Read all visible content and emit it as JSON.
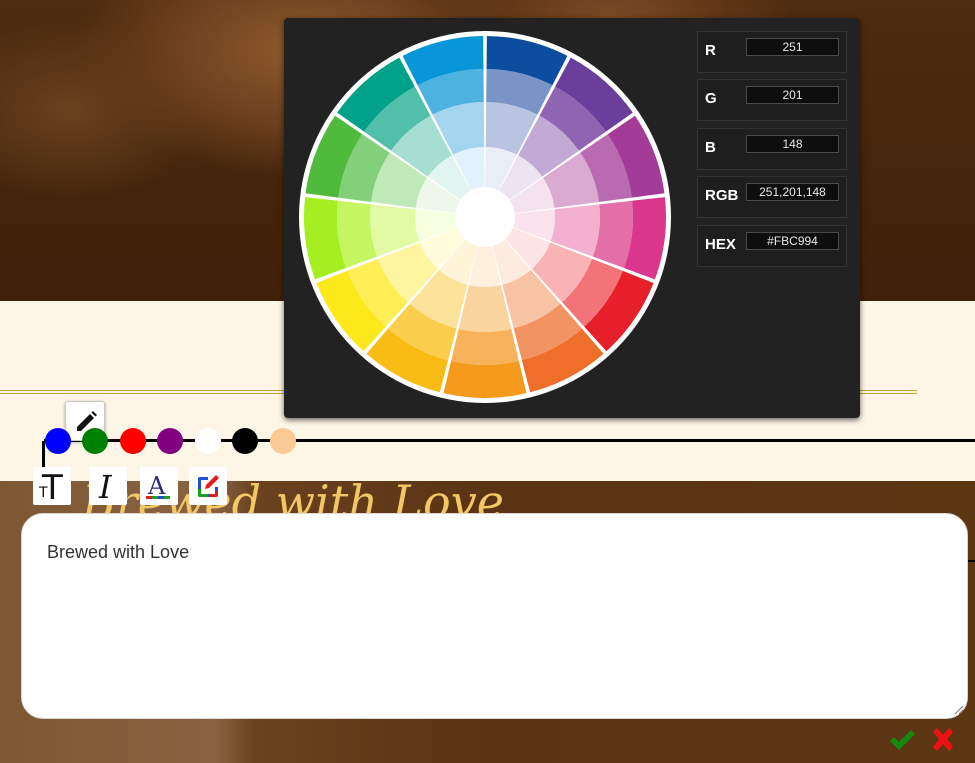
{
  "page": {
    "hero_heading": "Brewed with Love"
  },
  "color_picker": {
    "channels": [
      {
        "label": "R",
        "value": "251"
      },
      {
        "label": "G",
        "value": "201"
      },
      {
        "label": "B",
        "value": "148"
      },
      {
        "label": "RGB",
        "value": "251,201,148"
      },
      {
        "label": "HEX",
        "value": "#FBC994"
      }
    ],
    "wheel_colors": [
      [
        "#e8edf7",
        "#b9c4e0",
        "#7a94c8",
        "#0d4da0"
      ],
      [
        "#ece4f2",
        "#c2aad4",
        "#8e64b3",
        "#6a3e9b"
      ],
      [
        "#f4e2ef",
        "#dbaad2",
        "#b96ab0",
        "#a23c96"
      ],
      [
        "#fbe3ee",
        "#f3b1cf",
        "#e36ea8",
        "#d9368c"
      ],
      [
        "#fde5e5",
        "#f9b3b5",
        "#f27479",
        "#e61f2a"
      ],
      [
        "#fdebe0",
        "#f8c2a4",
        "#f29362",
        "#ef6f2a"
      ],
      [
        "#fef0dc",
        "#fbd5a0",
        "#f8b25a",
        "#f59a1c"
      ],
      [
        "#fff3d8",
        "#fde39a",
        "#fbce4d",
        "#f9bc14"
      ],
      [
        "#fffbdb",
        "#fff49f",
        "#ffee56",
        "#fde81c"
      ],
      [
        "#f6ffe0",
        "#e0fba4",
        "#c5f560",
        "#a4ee22"
      ],
      [
        "#eef8ea",
        "#bfe9b6",
        "#83d07a",
        "#4fba3c"
      ],
      [
        "#e3f5f1",
        "#a6ded2",
        "#52bfaa",
        "#02a18a"
      ],
      [
        "#e2f2fa",
        "#a3d5ef",
        "#4db2e0",
        "#0896d8"
      ]
    ]
  },
  "toolbar": {
    "pen_icon": "pencil-icon",
    "swatches": [
      {
        "name": "blue",
        "color": "#0000ff"
      },
      {
        "name": "green",
        "color": "#008000"
      },
      {
        "name": "red",
        "color": "#ff0000"
      },
      {
        "name": "purple",
        "color": "#800080"
      },
      {
        "name": "white",
        "color": "#ffffff"
      },
      {
        "name": "black",
        "color": "#000000"
      },
      {
        "name": "peach",
        "color": "#fbc994"
      }
    ],
    "tools": [
      {
        "name": "font-size-icon"
      },
      {
        "name": "italic-icon"
      },
      {
        "name": "text-color-icon"
      },
      {
        "name": "edit-icon"
      }
    ]
  },
  "editor": {
    "text": "Brewed with Love"
  },
  "actions": {
    "confirm_icon": "checkmark-icon",
    "cancel_icon": "close-icon",
    "confirm_color": "#118a11",
    "cancel_color": "#ee1111"
  }
}
